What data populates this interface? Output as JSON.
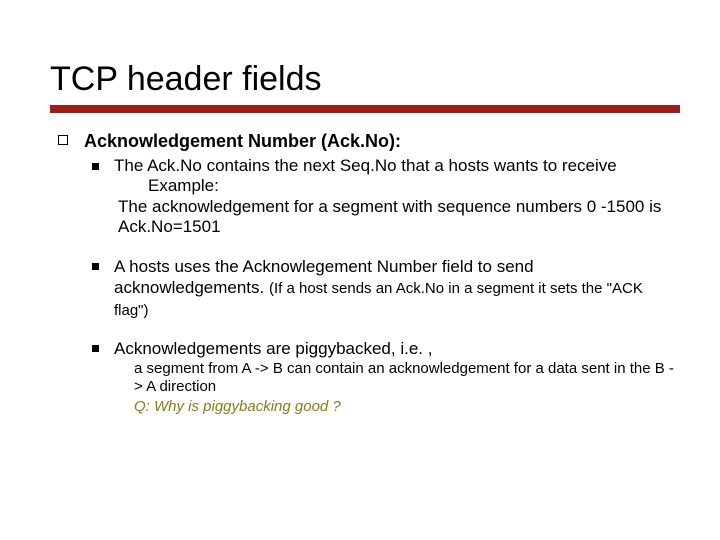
{
  "title": "TCP header fields",
  "section": {
    "heading": "Acknowledgement  Number (Ack.No):",
    "bullets": [
      {
        "text": "The Ack.No contains the next Seq.No that a hosts wants to receive",
        "example_label": "Example:",
        "example_text": "The acknowledgement  for a segment with sequence numbers 0 -1500 is Ack.No=1501"
      },
      {
        "text_a": "A hosts uses the Acknowlegement Number field to send acknowledgements. ",
        "text_b": "(If a host sends an Ack.No in a segment it sets the  \"ACK flag\")"
      },
      {
        "text": "Acknowledgements are piggybacked, i.e. ,",
        "sub_a": "a segment  from A -> B can contain an acknowledgement for a data sent in the B -> A direction",
        "question": "Q: Why is piggybacking good ?"
      }
    ]
  }
}
